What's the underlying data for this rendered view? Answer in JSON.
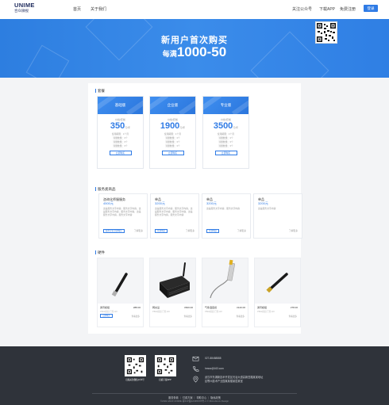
{
  "header": {
    "logo_main": "UNIME",
    "logo_sub": "合众微视",
    "nav": [
      "首页",
      "关于我们"
    ],
    "right_links": [
      "关注公众号",
      "下载APP",
      "免费注册"
    ],
    "login_label": "登录"
  },
  "banner": {
    "title": "新用户首次购买",
    "promo_prefix": "每满",
    "promo_value": "1000-50"
  },
  "pricing": {
    "section_title": "套餐",
    "plans": [
      {
        "name": "基础版",
        "label": "价格/套餐",
        "price": "350",
        "unit": "元/年",
        "lines": [
          "使用期限：1个月",
          "流量数量：3个",
          "流量数量：3个",
          "流量数量：3个"
        ],
        "button": "立即购买"
      },
      {
        "name": "企业版",
        "label": "价格/套餐",
        "price": "1900",
        "unit": "元/年",
        "lines": [
          "使用期限：1个月",
          "流量数量：3个",
          "流量数量：3个",
          "流量数量：3个"
        ],
        "button": "立即购买"
      },
      {
        "name": "专业版",
        "label": "价格/套餐",
        "price": "3500",
        "unit": "元/年",
        "lines": [
          "使用期限：1个月",
          "流量数量：3个",
          "流量数量：3个",
          "流量数量：3个"
        ],
        "button": "立即购买"
      }
    ]
  },
  "services": {
    "section_title": "服务类商品",
    "items": [
      {
        "title": "咨询化师服服务",
        "price": "4500元",
        "desc": "这是服务文字内容，服务文字内容，这是服务文字内容。服务文字内容，这是服务文字内容。服务文字内容",
        "button": "服务企业立即购买",
        "more": "了解更多"
      },
      {
        "title": "单品",
        "price": "3200元",
        "desc": "这是服务文字内容，服务文字内容，这是服务文字内容。服务文字内容，这是服务文字内容。服务文字内容",
        "button": "立即购买",
        "more": "了解更多"
      },
      {
        "title": "单品",
        "price": "3200元",
        "desc": "这是服务文字内容，服务文字内容",
        "button": "立即购买",
        "more": "了解更多"
      },
      {
        "title": "单品",
        "price": "3200元",
        "desc": "这是服务文字内容",
        "button": "",
        "more": "了解更多"
      }
    ]
  },
  "products": {
    "section_title": "硬件",
    "items": [
      {
        "name": "通讯模组",
        "price": "¥88.00",
        "sub": "PB02模组 已售120",
        "tag": "立即购买",
        "more": "查看更多"
      },
      {
        "name": "网关设",
        "price": "¥600.00",
        "sub": "PB02模组 已售120",
        "tag": "",
        "more": "查看更多"
      },
      {
        "name": "气象温度感",
        "price": "¥120.00",
        "sub": "PB02模组 已售120",
        "tag": "",
        "more": "查看更多"
      },
      {
        "name": "通讯模组",
        "price": "¥78.00",
        "sub": "PB02模组 已售120",
        "tag": "",
        "more": "查看更多"
      }
    ]
  },
  "footer": {
    "qr_labels": [
      "扫描关注微信公众号",
      "扫描下载APP"
    ],
    "phone": "027-88488888",
    "email": "hmwz@163.com",
    "address_line1": "武汉市东湖新技术开发区光谷大道高新四路某某地址",
    "address_line2": "区鄂州技术产业园某某楼某层某室",
    "links": "服务条款 ｜ 付费方案 ｜ 帮助中心 ｜ 隐私政策",
    "copyright": "©2022-2023 UNIME 鄂ICP备12345678号-1 © Microbimix Design"
  },
  "colors": {
    "accent": "#2f7be5",
    "footer_bg": "#2f333a",
    "page_bg": "#f3f4f6"
  }
}
